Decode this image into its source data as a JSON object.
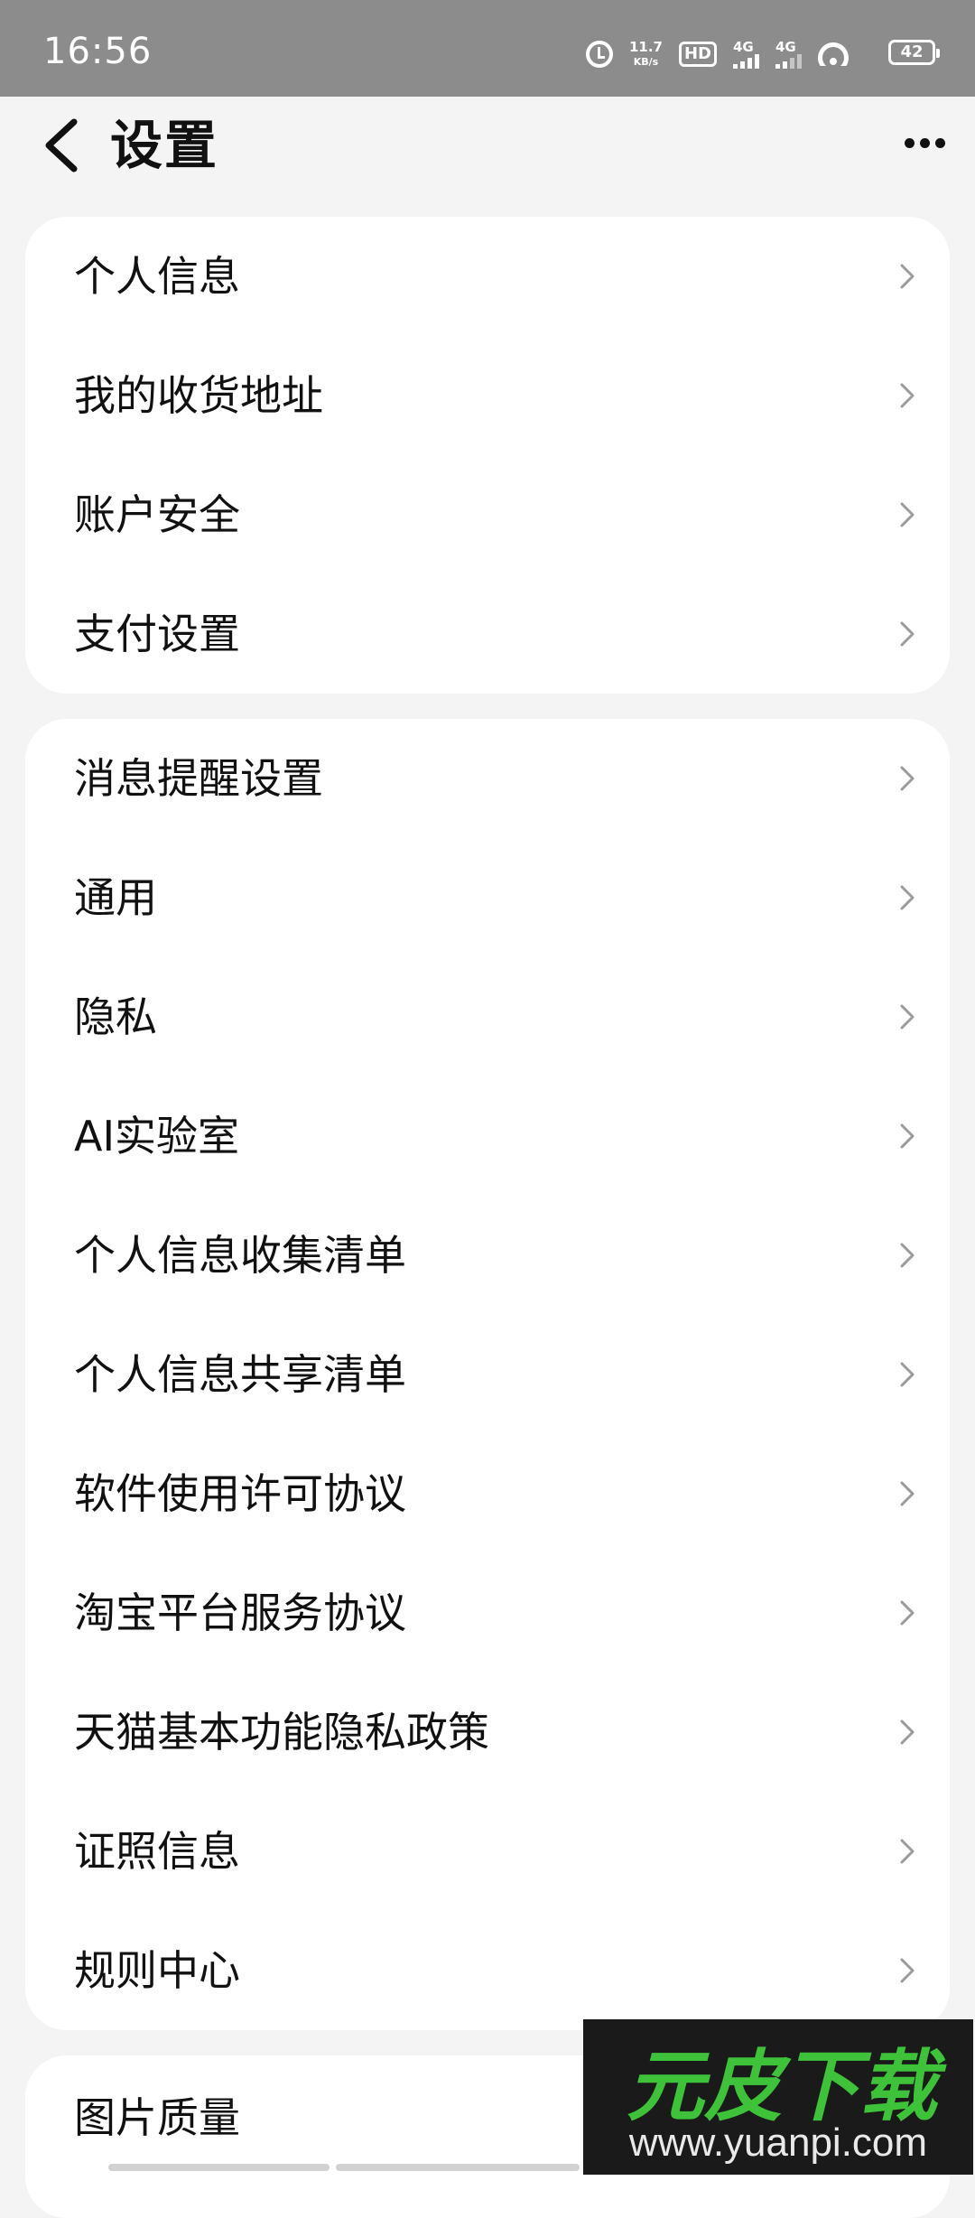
{
  "status_bar": {
    "time": "16:56",
    "net_speed_value": "11.7",
    "net_speed_unit": "KB/s",
    "hd_label": "HD",
    "sim1_type": "4G",
    "sim2_type": "4G",
    "battery": "42"
  },
  "header": {
    "title": "设置"
  },
  "groups": {
    "account": [
      "个人信息",
      "我的收货地址",
      "账户安全",
      "支付设置"
    ],
    "general": [
      "消息提醒设置",
      "通用",
      "隐私",
      "AI实验室",
      "个人信息收集清单",
      "个人信息共享清单",
      "软件使用许可协议",
      "淘宝平台服务协议",
      "天猫基本功能隐私政策",
      "证照信息",
      "规则中心"
    ],
    "media": [
      "图片质量"
    ]
  },
  "watermark": {
    "logo": "元皮下载",
    "url": "www.yuanpi.com"
  },
  "colors": {
    "status_bg": "#8c8c8c",
    "page_bg": "#f4f4f4",
    "card_bg": "#ffffff",
    "chevron": "#9a9a9a",
    "logo_green": "#3ec23a"
  },
  "icons": {
    "back": "chevron-left-icon",
    "more": "more-dots-icon",
    "row": "chevron-right-icon"
  }
}
